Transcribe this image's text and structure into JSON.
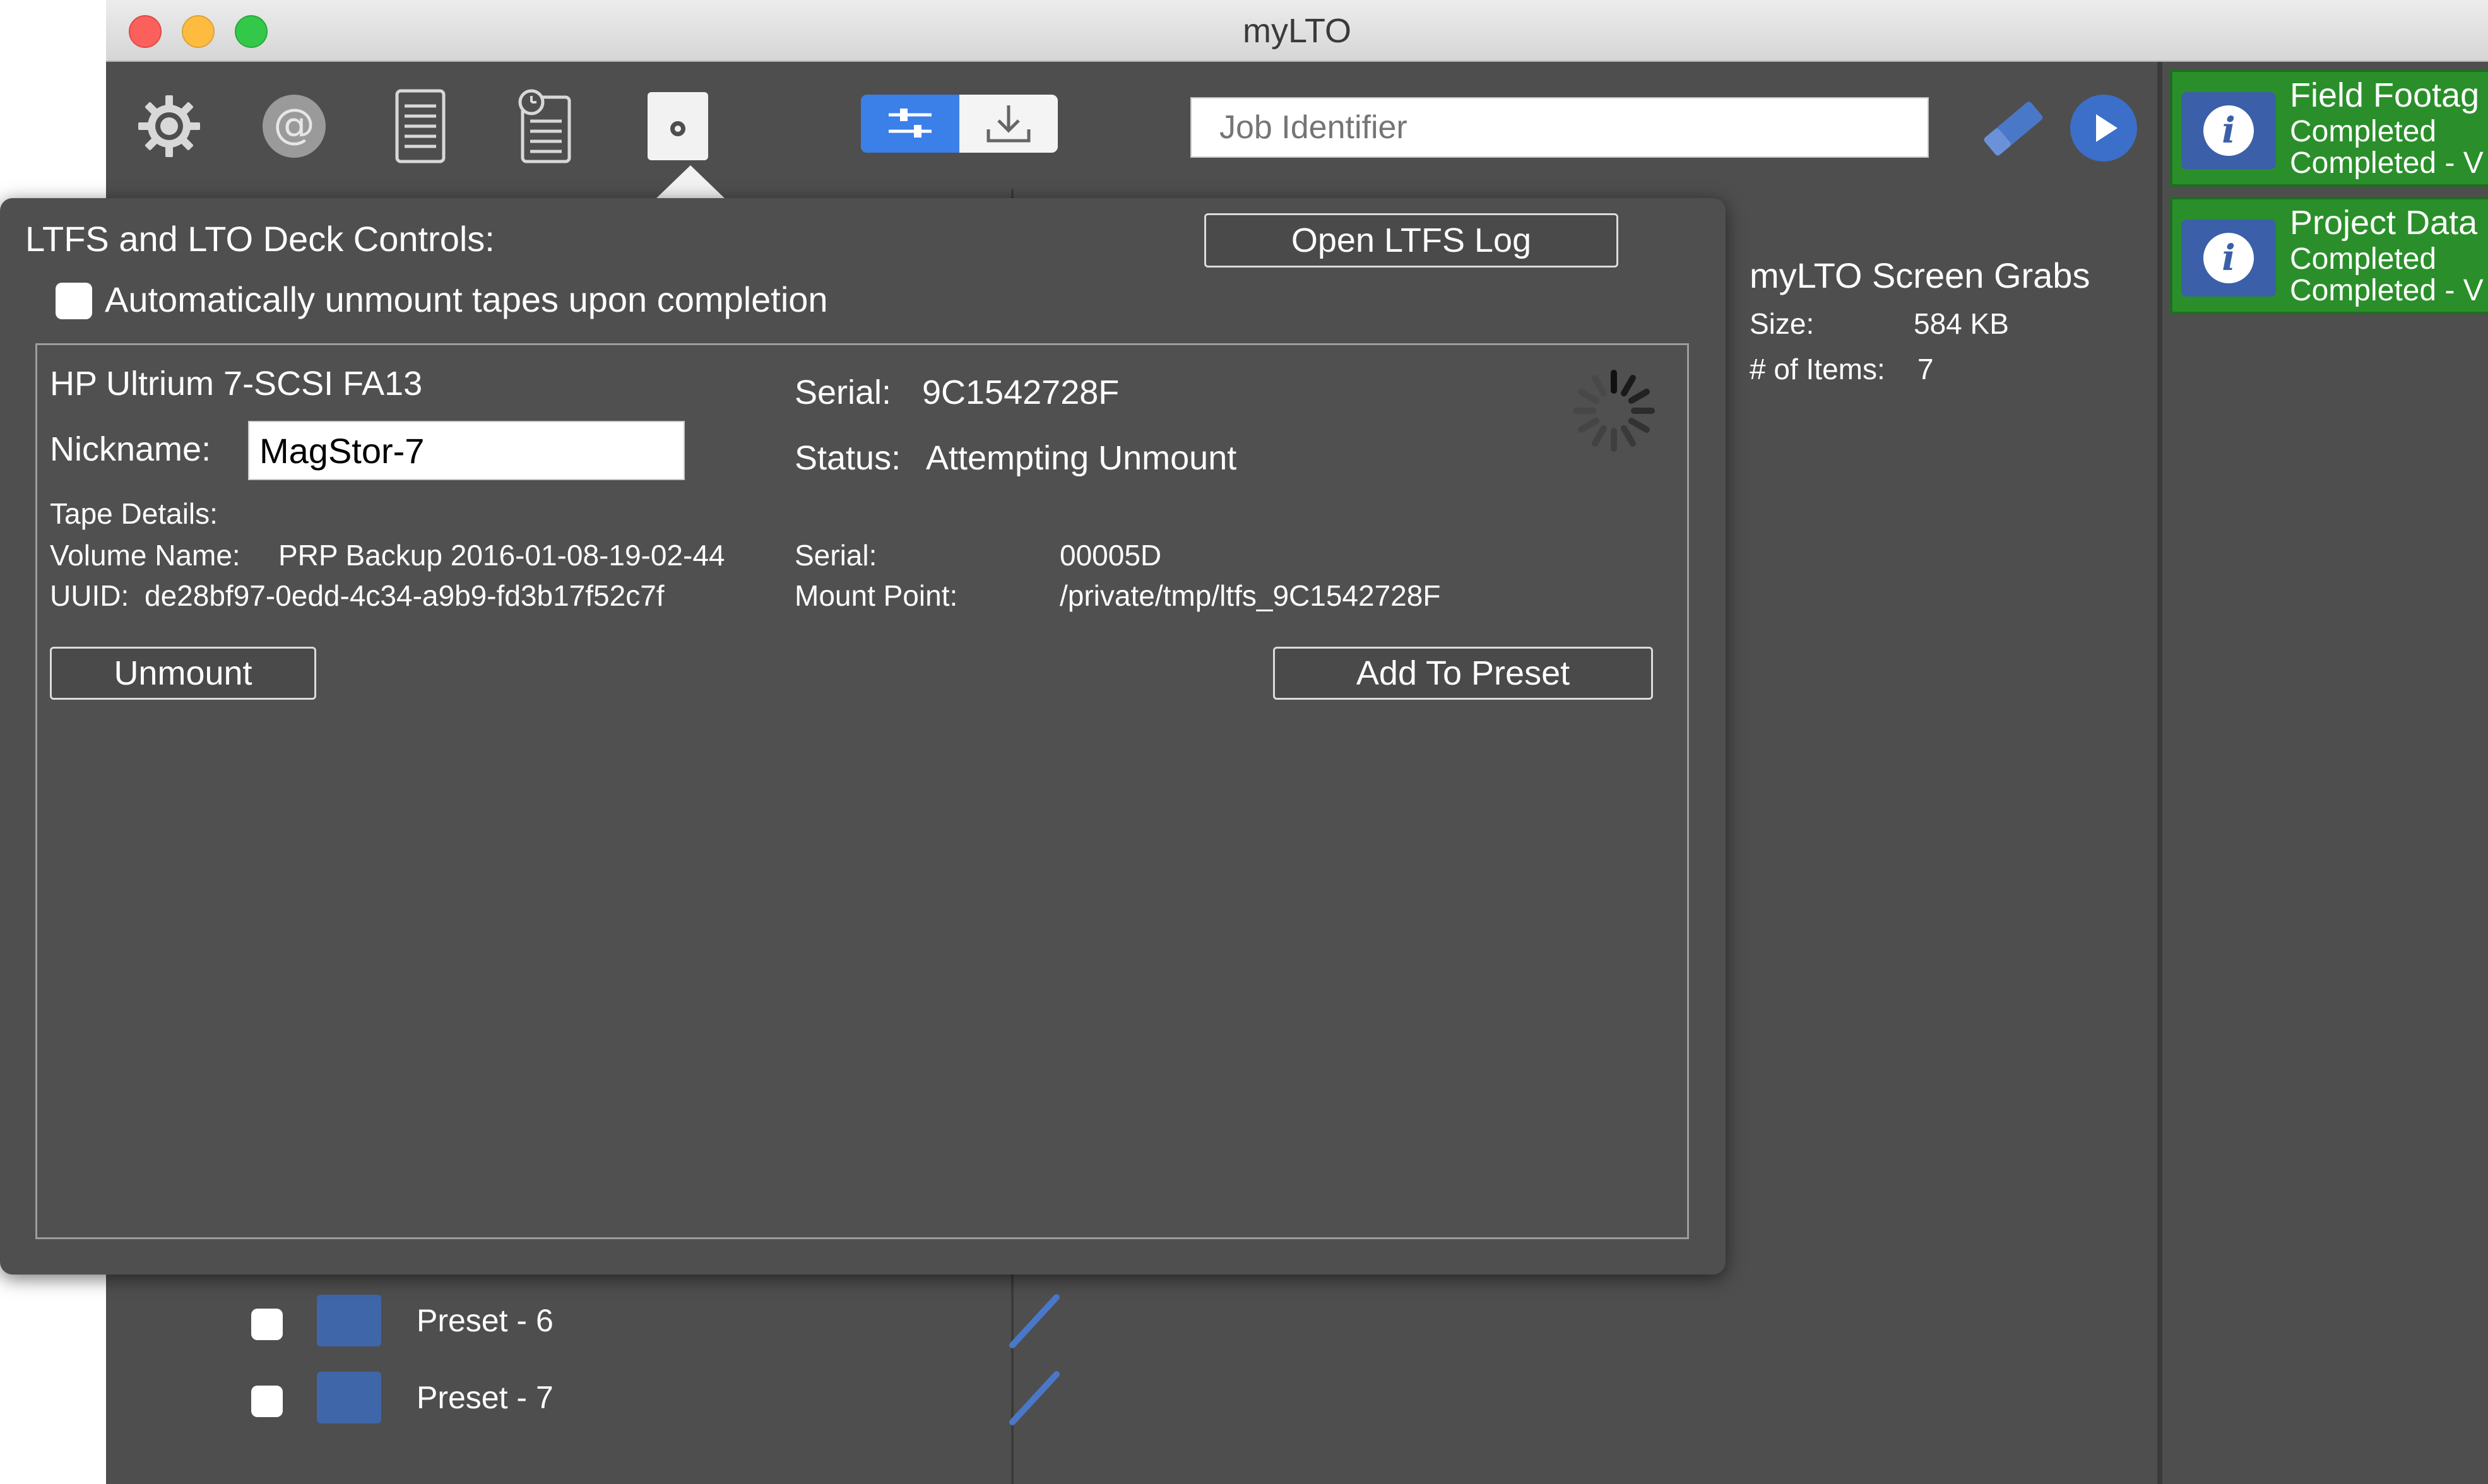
{
  "window": {
    "title": "myLTO"
  },
  "toolbar": {
    "icons": [
      "gear-icon",
      "at-icon",
      "document-icon",
      "history-icon",
      "tape-drive-icon"
    ],
    "segment": {
      "left_icon": "sliders-icon",
      "right_icon": "download-icon"
    },
    "job_identifier_placeholder": "Job Identifier",
    "actions": [
      "eraser-icon",
      "play-icon"
    ]
  },
  "popover": {
    "heading": "LTFS and LTO Deck Controls:",
    "open_log_label": "Open LTFS Log",
    "auto_unmount_label": "Automatically unmount tapes upon completion",
    "deck": {
      "model": "HP Ultrium 7-SCSI FA13",
      "nickname_label": "Nickname:",
      "nickname_value": "MagStor-7",
      "serial_label": "Serial:",
      "serial_value": "9C1542728F",
      "status_label": "Status:",
      "status_value": "Attempting Unmount",
      "tape_details_label": "Tape Details:",
      "volume_name_label": "Volume Name:",
      "volume_name_value": "PRP Backup 2016-01-08-19-02-44",
      "uuid_label": "UUID:",
      "uuid_value": "de28bf97-0edd-4c34-a9b9-fd3b17f52c7f",
      "tape_serial_label": "Serial:",
      "tape_serial_value": "00005D",
      "mount_point_label": "Mount Point:",
      "mount_point_value": "/private/tmp/ltfs_9C1542728F",
      "unmount_label": "Unmount",
      "add_to_preset_label": "Add To Preset"
    }
  },
  "info": {
    "title": "myLTO Screen Grabs",
    "size_label": "Size:",
    "size_value": "584 KB",
    "items_label": "# of Items:",
    "items_value": "7"
  },
  "presets": [
    {
      "label": "Preset - 6"
    },
    {
      "label": "Preset - 7"
    }
  ],
  "queue": [
    {
      "title": "Field Footag",
      "line1": "Completed",
      "line2": "Completed - V"
    },
    {
      "title": "Project Data",
      "line1": "Completed",
      "line2": "Completed - V"
    }
  ],
  "colors": {
    "close": "#fc605c",
    "minimize": "#fdbc40",
    "zoom": "#34c84a",
    "job_complete": "#2a8f2a",
    "preset_swatch": "#3f66a9",
    "accent": "#3b7fe8"
  }
}
